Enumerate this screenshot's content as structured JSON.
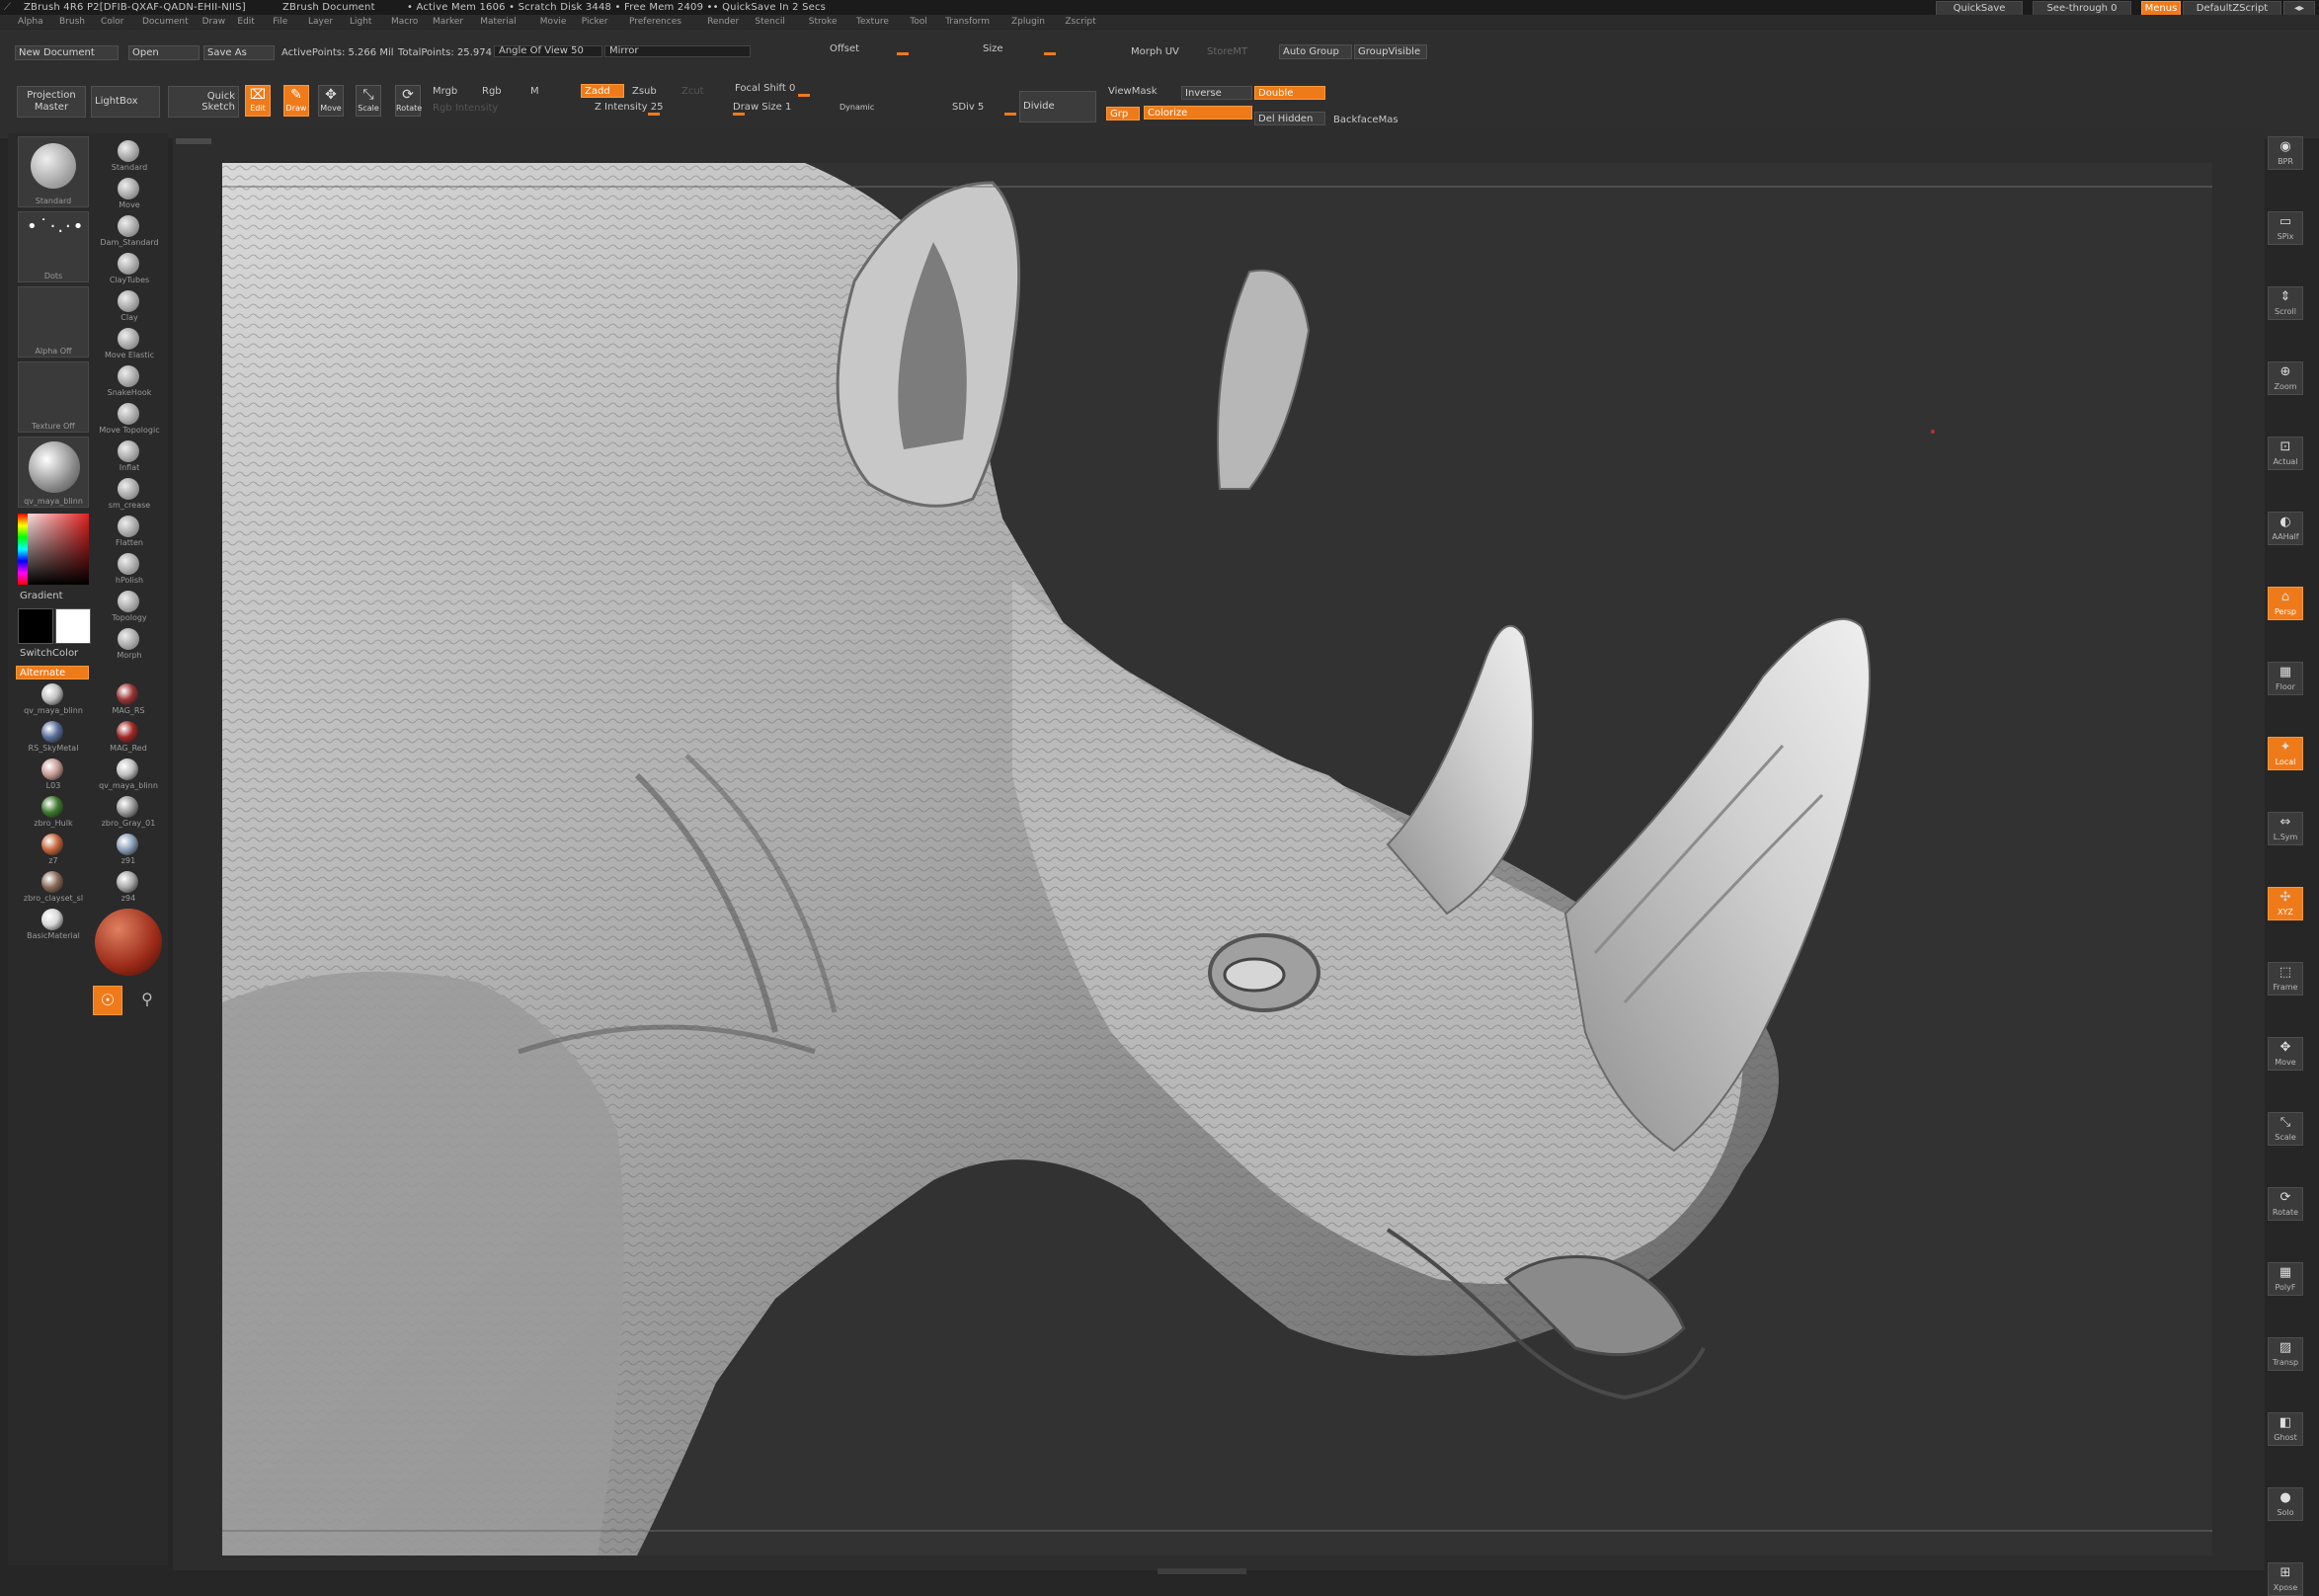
{
  "title_bar": {
    "app": "ZBrush 4R6 P2[DFIB-QXAF-QADN-EHII-NIIS]",
    "document": "ZBrush Document",
    "status": "• Active Mem 1606 • Scratch Disk 3448 • Free Mem 2409 •• QuickSave In 2 Secs",
    "quicksave": "QuickSave",
    "see_through": "See-through  0",
    "menus": "Menus",
    "script": "DefaultZScript"
  },
  "menu": [
    "Alpha",
    "Brush",
    "Color",
    "Document",
    "Draw",
    "Edit",
    "File",
    "Layer",
    "Light",
    "Macro",
    "Marker",
    "Material",
    "Movie",
    "Picker",
    "Preferences",
    "Render",
    "Stencil",
    "Stroke",
    "Texture",
    "Tool",
    "Transform",
    "Zplugin",
    "Zscript"
  ],
  "shelf": {
    "new_document": "New Document",
    "open": "Open",
    "save_as": "Save As",
    "active_points": "ActivePoints: 5.266 Mil",
    "total_points": "TotalPoints: 25.974 Mil",
    "angle_of_view": "Angle Of View 50",
    "mirror": "Mirror",
    "offset": "Offset",
    "size": "Size",
    "morph_uv": "Morph UV",
    "storemt": "StoreMT",
    "auto_group": "Auto Group",
    "group_visible": "GroupVisible",
    "projection_master": "Projection Master",
    "lightbox": "LightBox",
    "quick_sketch": "Quick Sketch",
    "edit": "Edit",
    "draw": "Draw",
    "move": "Move",
    "scale": "Scale",
    "rotate": "Rotate",
    "mrgb": "Mrgb",
    "rgb": "Rgb",
    "m": "M",
    "rgb_intensity": "Rgb Intensity",
    "zadd": "Zadd",
    "zsub": "Zsub",
    "zcut": "Zcut",
    "z_intensity": "Z Intensity 25",
    "focal_shift": "Focal Shift 0",
    "draw_size": "Draw Size 1",
    "dynamic": "Dynamic",
    "sdiv": "SDiv 5",
    "divide": "Divide",
    "viewmask": "ViewMask",
    "inverse": "Inverse",
    "double": "Double",
    "grp": "Grp",
    "colorize": "Colorize",
    "del_hidden": "Del Hidden",
    "backface": "BackfaceMas"
  },
  "left_tray": {
    "standard": "Standard",
    "dots": "Dots",
    "alpha_off": "Alpha Off",
    "texture_off": "Texture Off",
    "material_main": "qv_maya_blinn",
    "gradient": "Gradient",
    "switchcolor": "SwitchColor",
    "alternate": "Alternate",
    "brushes": [
      "Standard",
      "Move",
      "Dam_Standard",
      "ClayTubes",
      "Clay",
      "Move Elastic",
      "SnakeHook",
      "Move Topologic",
      "Inflat",
      "sm_crease",
      "Flatten",
      "hPolish",
      "Topology",
      "Morph"
    ],
    "materials": [
      {
        "name": "qv_maya_blinn",
        "color": "#bfbfbf"
      },
      {
        "name": "MAG_RS",
        "color": "#9a3434"
      },
      {
        "name": "RS_SkyMetal",
        "color": "#5a6f9a"
      },
      {
        "name": "MAG_Red",
        "color": "#a02828"
      },
      {
        "name": "L03",
        "color": "#c79c94"
      },
      {
        "name": "qv_maya_blinn",
        "color": "#bfbfbf"
      },
      {
        "name": "zbro_Hulk",
        "color": "#3f7a2e"
      },
      {
        "name": "zbro_Gray_01",
        "color": "#9a9a9a"
      },
      {
        "name": "z7",
        "color": "#c4663a"
      },
      {
        "name": "z91",
        "color": "#8aa0b8"
      },
      {
        "name": "zbro_clayset_sl",
        "color": "#8a6a58"
      },
      {
        "name": "z94",
        "color": "#a8a8a8"
      },
      {
        "name": "BasicMaterial",
        "color": "#d8d8d8"
      }
    ]
  },
  "right_tray": [
    "BPR",
    "SPix",
    "Scroll",
    "Zoom",
    "Actual",
    "AAHalf",
    "Persp",
    "Floor",
    "Local",
    "L.Sym",
    "XYZ",
    "Frame",
    "Move",
    "Scale",
    "Rotate",
    "PolyF",
    "Transp",
    "Ghost",
    "Solo",
    "Xpose"
  ],
  "colors": {
    "accent": "#ef7a1a",
    "panel": "#2e2e2e",
    "canvas": "#323232"
  }
}
